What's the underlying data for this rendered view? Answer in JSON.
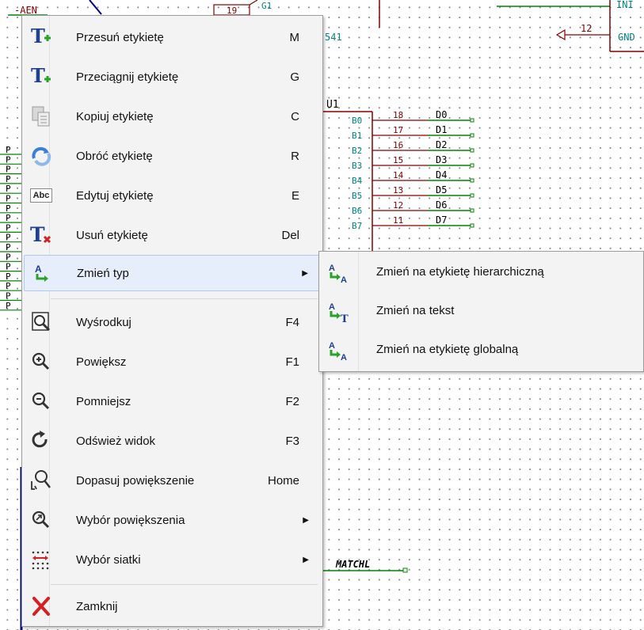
{
  "schematic": {
    "ref_u1": "U1",
    "ref_541": "541",
    "top_partial_label": "-AEN",
    "pin_number_top": "19",
    "pin_number_gnd": "12",
    "gnd_label": "GND",
    "top_right_partial": "INI",
    "top_partial_g1": "G1",
    "pins": [
      {
        "pin": "B0",
        "num": "18",
        "net": "D0"
      },
      {
        "pin": "B1",
        "num": "17",
        "net": "D1"
      },
      {
        "pin": "B2",
        "num": "16",
        "net": "D2"
      },
      {
        "pin": "B3",
        "num": "15",
        "net": "D3"
      },
      {
        "pin": "B4",
        "num": "14",
        "net": "D4"
      },
      {
        "pin": "B5",
        "num": "13",
        "net": "D5"
      },
      {
        "pin": "B6",
        "num": "12",
        "net": "D6"
      },
      {
        "pin": "B7",
        "num": "11",
        "net": "D7"
      }
    ],
    "matchl_label": "MATCHL",
    "left_p_labels": [
      "P",
      "P",
      "P",
      "P",
      "P",
      "P",
      "P",
      "P",
      "P",
      "P",
      "P",
      "P",
      "P",
      "P",
      "P",
      "P",
      "P"
    ]
  },
  "context_menu": {
    "items": [
      {
        "label": "Przesuń etykietę",
        "shortcut": "M",
        "icon": "move-label-icon"
      },
      {
        "label": "Przeciągnij etykietę",
        "shortcut": "G",
        "icon": "drag-label-icon"
      },
      {
        "label": "Kopiuj etykietę",
        "shortcut": "C",
        "icon": "copy-label-icon"
      },
      {
        "label": "Obróć etykietę",
        "shortcut": "R",
        "icon": "rotate-label-icon"
      },
      {
        "label": "Edytuj etykietę",
        "shortcut": "E",
        "icon": "edit-label-icon",
        "icon_text": "Abc"
      },
      {
        "label": "Usuń etykietę",
        "shortcut": "Del",
        "icon": "delete-label-icon"
      },
      {
        "label": "Zmień typ",
        "shortcut": "",
        "icon": "change-type-icon",
        "submenu": true,
        "selected": true
      },
      {
        "label": "Wyśrodkuj",
        "shortcut": "F4",
        "icon": "center-icon"
      },
      {
        "label": "Powiększ",
        "shortcut": "F1",
        "icon": "zoom-in-icon"
      },
      {
        "label": "Pomniejsz",
        "shortcut": "F2",
        "icon": "zoom-out-icon"
      },
      {
        "label": "Odśwież widok",
        "shortcut": "F3",
        "icon": "refresh-icon"
      },
      {
        "label": "Dopasuj powiększenie",
        "shortcut": "Home",
        "icon": "zoom-fit-icon"
      },
      {
        "label": "Wybór powiększenia",
        "shortcut": "",
        "icon": "zoom-select-icon",
        "submenu": true
      },
      {
        "label": "Wybór siatki",
        "shortcut": "",
        "icon": "grid-select-icon",
        "submenu": true
      },
      {
        "label": "Zamknij",
        "shortcut": "",
        "icon": "close-icon"
      }
    ]
  },
  "submenu": {
    "items": [
      {
        "label": "Zmień na etykietę hierarchiczną",
        "icon": "hierarchical-label-icon"
      },
      {
        "label": "Zmień na tekst",
        "icon": "text-icon"
      },
      {
        "label": "Zmień na etykietę globalną",
        "icon": "global-label-icon"
      }
    ]
  },
  "colors": {
    "wire": "#008400",
    "component": "#840000",
    "pin_text": "#008484",
    "menu_bg": "#f3f3f3",
    "selected_bg": "#e6eefb",
    "delete_red": "#d42020",
    "icon_blue": "#1f3f8f"
  }
}
